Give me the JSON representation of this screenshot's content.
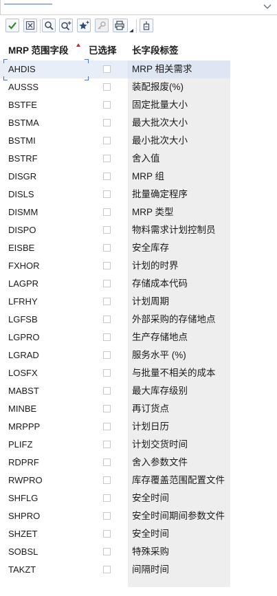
{
  "toolbar": {
    "buttons": [
      {
        "name": "confirm-button",
        "icon": "check-icon"
      },
      {
        "name": "cancel-button",
        "icon": "close-box-icon"
      },
      {
        "name": "find-button",
        "icon": "magnifier-icon"
      },
      {
        "name": "find-next-button",
        "icon": "magnifier-plus-icon"
      },
      {
        "name": "favorites-button",
        "icon": "star-plus-icon"
      },
      {
        "name": "info-button",
        "icon": "key-icon"
      },
      {
        "name": "print-button",
        "icon": "printer-icon"
      },
      {
        "name": "settings-button",
        "icon": "clipboard-icon"
      }
    ]
  },
  "table": {
    "columns": [
      "MRP 范围字段",
      "已选择",
      "长字段标签"
    ],
    "rows": [
      {
        "field": "AHDIS",
        "selected": false,
        "label": "MRP 相关需求"
      },
      {
        "field": "AUSSS",
        "selected": false,
        "label": "装配报废(%)"
      },
      {
        "field": "BSTFE",
        "selected": false,
        "label": "固定批量大小"
      },
      {
        "field": "BSTMA",
        "selected": false,
        "label": "最大批次大小"
      },
      {
        "field": "BSTMI",
        "selected": false,
        "label": "最小批次大小"
      },
      {
        "field": "BSTRF",
        "selected": false,
        "label": "舍入值"
      },
      {
        "field": "DISGR",
        "selected": false,
        "label": "MRP 组"
      },
      {
        "field": "DISLS",
        "selected": false,
        "label": "批量确定程序"
      },
      {
        "field": "DISMM",
        "selected": false,
        "label": "MRP 类型"
      },
      {
        "field": "DISPO",
        "selected": false,
        "label": "物料需求计划控制员"
      },
      {
        "field": "EISBE",
        "selected": false,
        "label": "安全库存"
      },
      {
        "field": "FXHOR",
        "selected": false,
        "label": "计划的时界"
      },
      {
        "field": "LAGPR",
        "selected": false,
        "label": "存储成本代码"
      },
      {
        "field": "LFRHY",
        "selected": false,
        "label": "计划周期"
      },
      {
        "field": "LGFSB",
        "selected": false,
        "label": "外部采购的存储地点"
      },
      {
        "field": "LGPRO",
        "selected": false,
        "label": "生产存储地点"
      },
      {
        "field": "LGRAD",
        "selected": false,
        "label": "服务水平 (%)"
      },
      {
        "field": "LOSFX",
        "selected": false,
        "label": "与批量不相关的成本"
      },
      {
        "field": "MABST",
        "selected": false,
        "label": "最大库存级别"
      },
      {
        "field": "MINBE",
        "selected": false,
        "label": "再订货点"
      },
      {
        "field": "MRPPP",
        "selected": false,
        "label": "计划日历"
      },
      {
        "field": "PLIFZ",
        "selected": false,
        "label": "计划交货时间"
      },
      {
        "field": "RDPRF",
        "selected": false,
        "label": "舍入参数文件"
      },
      {
        "field": "RWPRO",
        "selected": false,
        "label": "库存覆盖范围配置文件"
      },
      {
        "field": "SHFLG",
        "selected": false,
        "label": "安全时间"
      },
      {
        "field": "SHPRO",
        "selected": false,
        "label": "安全时间期间参数文件"
      },
      {
        "field": "SHZET",
        "selected": false,
        "label": "安全时间"
      },
      {
        "field": "SOBSL",
        "selected": false,
        "label": "特殊采购"
      },
      {
        "field": "TAKZT",
        "selected": false,
        "label": "间隔时间"
      }
    ]
  },
  "colors": {
    "accent": "#4a73b5",
    "selected_row": "#e7eef8",
    "sort_indicator": "#d0212b",
    "check_green": "#2e8b2e"
  }
}
